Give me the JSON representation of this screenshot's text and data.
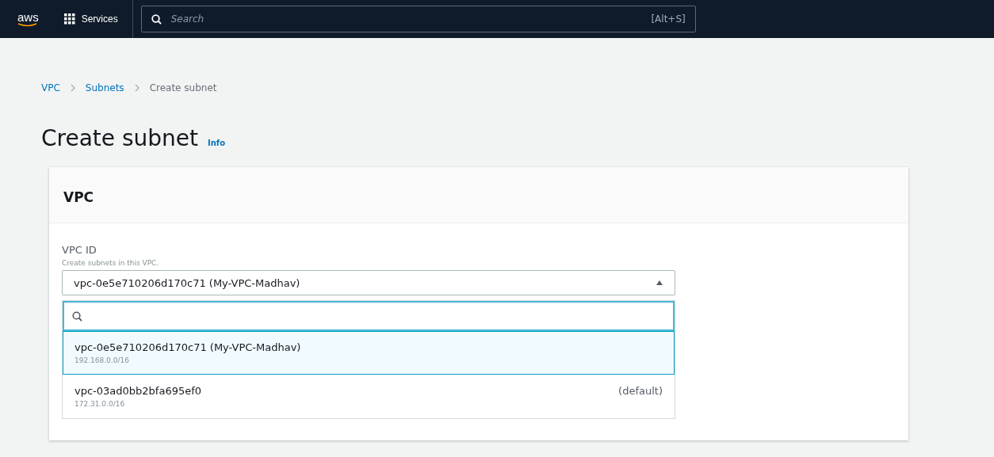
{
  "top_bar": {
    "logo": "aws",
    "services": "Services",
    "search": {
      "placeholder": "Search",
      "shortcut": "[Alt+S]"
    }
  },
  "breadcrumbs": [
    {
      "label": "VPC",
      "link": true
    },
    {
      "label": "Subnets",
      "link": true
    },
    {
      "label": "Create subnet",
      "link": false
    }
  ],
  "page_title": "Create subnet",
  "info_link": "Info",
  "card": {
    "title": "VPC",
    "field": {
      "label": "VPC ID",
      "description": "Create subnets in this VPC.",
      "value": "vpc-0e5e710206d170c71 (My-VPC-Madhav)",
      "expanded": true,
      "options": [
        {
          "label": "vpc-0e5e710206d170c71 (My-VPC-Madhav)",
          "description": "192.168.0.0/16",
          "selected": true
        },
        {
          "label": "vpc-03ad0bb2bfa695ef0",
          "description": "172.31.0.0/16",
          "tag": "(default)",
          "selected": false
        }
      ]
    }
  }
}
